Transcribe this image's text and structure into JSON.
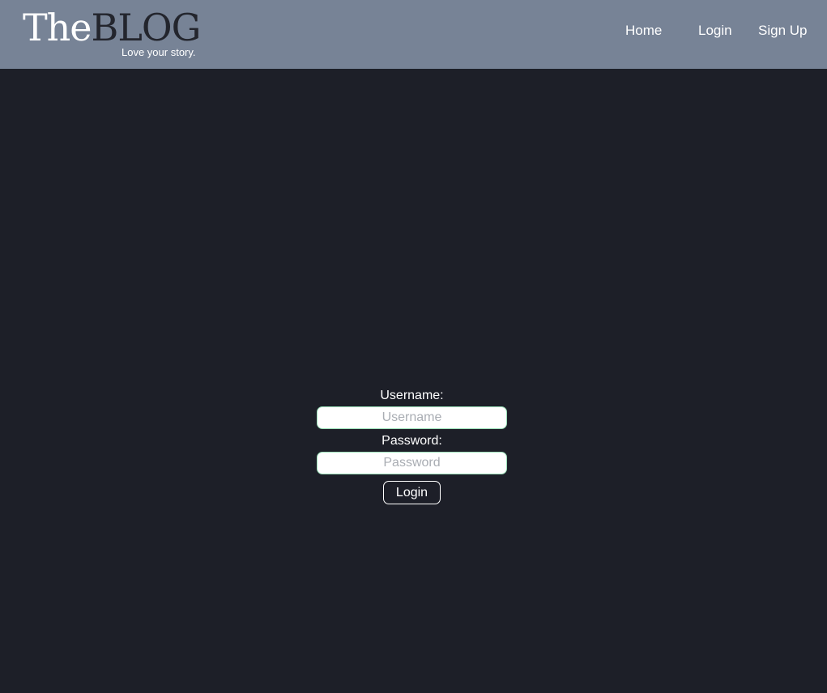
{
  "brand": {
    "title_prefix": "The",
    "title_suffix": "BLOG",
    "tagline": "Love your story."
  },
  "nav": {
    "home": "Home",
    "login": "Login",
    "signup": "Sign Up"
  },
  "form": {
    "username_label": "Username:",
    "username_placeholder": "Username",
    "username_value": "",
    "password_label": "Password:",
    "password_placeholder": "Password",
    "password_value": "",
    "submit_label": "Login"
  },
  "colors": {
    "header_bg": "#778396",
    "page_bg": "#1d1f28",
    "input_border": "#9adfb8"
  }
}
